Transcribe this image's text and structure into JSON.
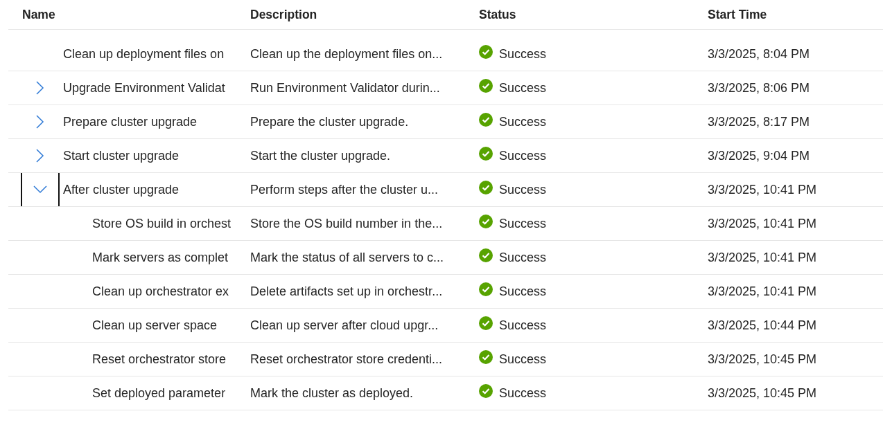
{
  "table": {
    "columns": [
      "Name",
      "Description",
      "Status",
      "Start Time"
    ],
    "rows": [
      {
        "name": "Clean up deployment files on",
        "description": "Clean up the deployment files on...",
        "status": {
          "kind": "success",
          "label": "Success"
        },
        "start_time": "3/3/2025, 8:04 PM"
      },
      {
        "name": "Upgrade Environment Validat",
        "expanded": false,
        "focused": false,
        "description": "Run Environment Validator durin...",
        "status": {
          "kind": "success",
          "label": "Success"
        },
        "start_time": "3/3/2025, 8:06 PM"
      },
      {
        "name": "Prepare cluster upgrade",
        "expanded": false,
        "focused": false,
        "description": "Prepare the cluster upgrade.",
        "status": {
          "kind": "success",
          "label": "Success"
        },
        "start_time": "3/3/2025, 8:17 PM"
      },
      {
        "name": "Start cluster upgrade",
        "expanded": false,
        "focused": false,
        "description": "Start the cluster upgrade.",
        "status": {
          "kind": "success",
          "label": "Success"
        },
        "start_time": "3/3/2025, 9:04 PM"
      },
      {
        "name": "After cluster upgrade",
        "expanded": true,
        "focused": true,
        "description": "Perform steps after the cluster u...",
        "status": {
          "kind": "success",
          "label": "Success"
        },
        "start_time": "3/3/2025, 10:41 PM",
        "children": [
          {
            "name": "Store OS build in orchest",
            "description": "Store the OS build number in the...",
            "status": {
              "kind": "success",
              "label": "Success"
            },
            "start_time": "3/3/2025, 10:41 PM"
          },
          {
            "name": "Mark servers as complet",
            "description": "Mark the status of all servers to c...",
            "status": {
              "kind": "success",
              "label": "Success"
            },
            "start_time": "3/3/2025, 10:41 PM"
          },
          {
            "name": "Clean up orchestrator ex",
            "description": "Delete artifacts set up in orchestr...",
            "status": {
              "kind": "success",
              "label": "Success"
            },
            "start_time": "3/3/2025, 10:41 PM"
          },
          {
            "name": "Clean up server space",
            "description": "Clean up server after cloud upgr...",
            "status": {
              "kind": "success",
              "label": "Success"
            },
            "start_time": "3/3/2025, 10:44 PM"
          },
          {
            "name": "Reset orchestrator store",
            "description": "Reset orchestrator store credenti...",
            "status": {
              "kind": "success",
              "label": "Success"
            },
            "start_time": "3/3/2025, 10:45 PM"
          },
          {
            "name": "Set deployed parameter",
            "description": "Mark the cluster as deployed.",
            "status": {
              "kind": "success",
              "label": "Success"
            },
            "start_time": "3/3/2025, 10:45 PM"
          }
        ]
      }
    ]
  }
}
